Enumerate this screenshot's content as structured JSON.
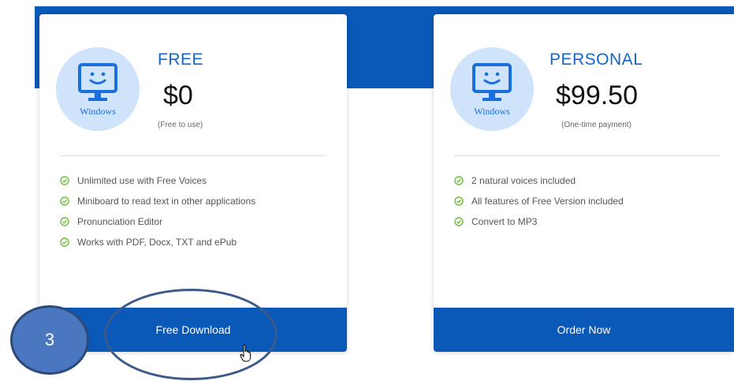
{
  "free_plan": {
    "icon_label": "Windows",
    "name": "FREE",
    "price": "$0",
    "note": "(Free to use)",
    "features": [
      "Unlimited use with Free Voices",
      "Miniboard to read text in other applications",
      "Pronunciation Editor",
      "Works with PDF, Docx, TXT and ePub"
    ],
    "button_label": "Free Download"
  },
  "personal_plan": {
    "icon_label": "Windows",
    "name": "PERSONAL",
    "price": "$99.50",
    "note": "(One-time payment)",
    "features": [
      "2 natural voices included",
      "All features of Free Version included",
      "Convert to MP3"
    ],
    "button_label": "Order Now"
  },
  "annotation": {
    "step_number": "3"
  },
  "colors": {
    "brand_blue": "#0a58b8",
    "icon_blue": "#1a6fdc",
    "icon_bg": "#cfe3fb",
    "check_green": "#6cbf3a"
  },
  "icons": {
    "plan_icon": "monitor-smiley-icon",
    "feature_icon": "check-circle-icon",
    "cursor": "hand-pointer-icon"
  }
}
